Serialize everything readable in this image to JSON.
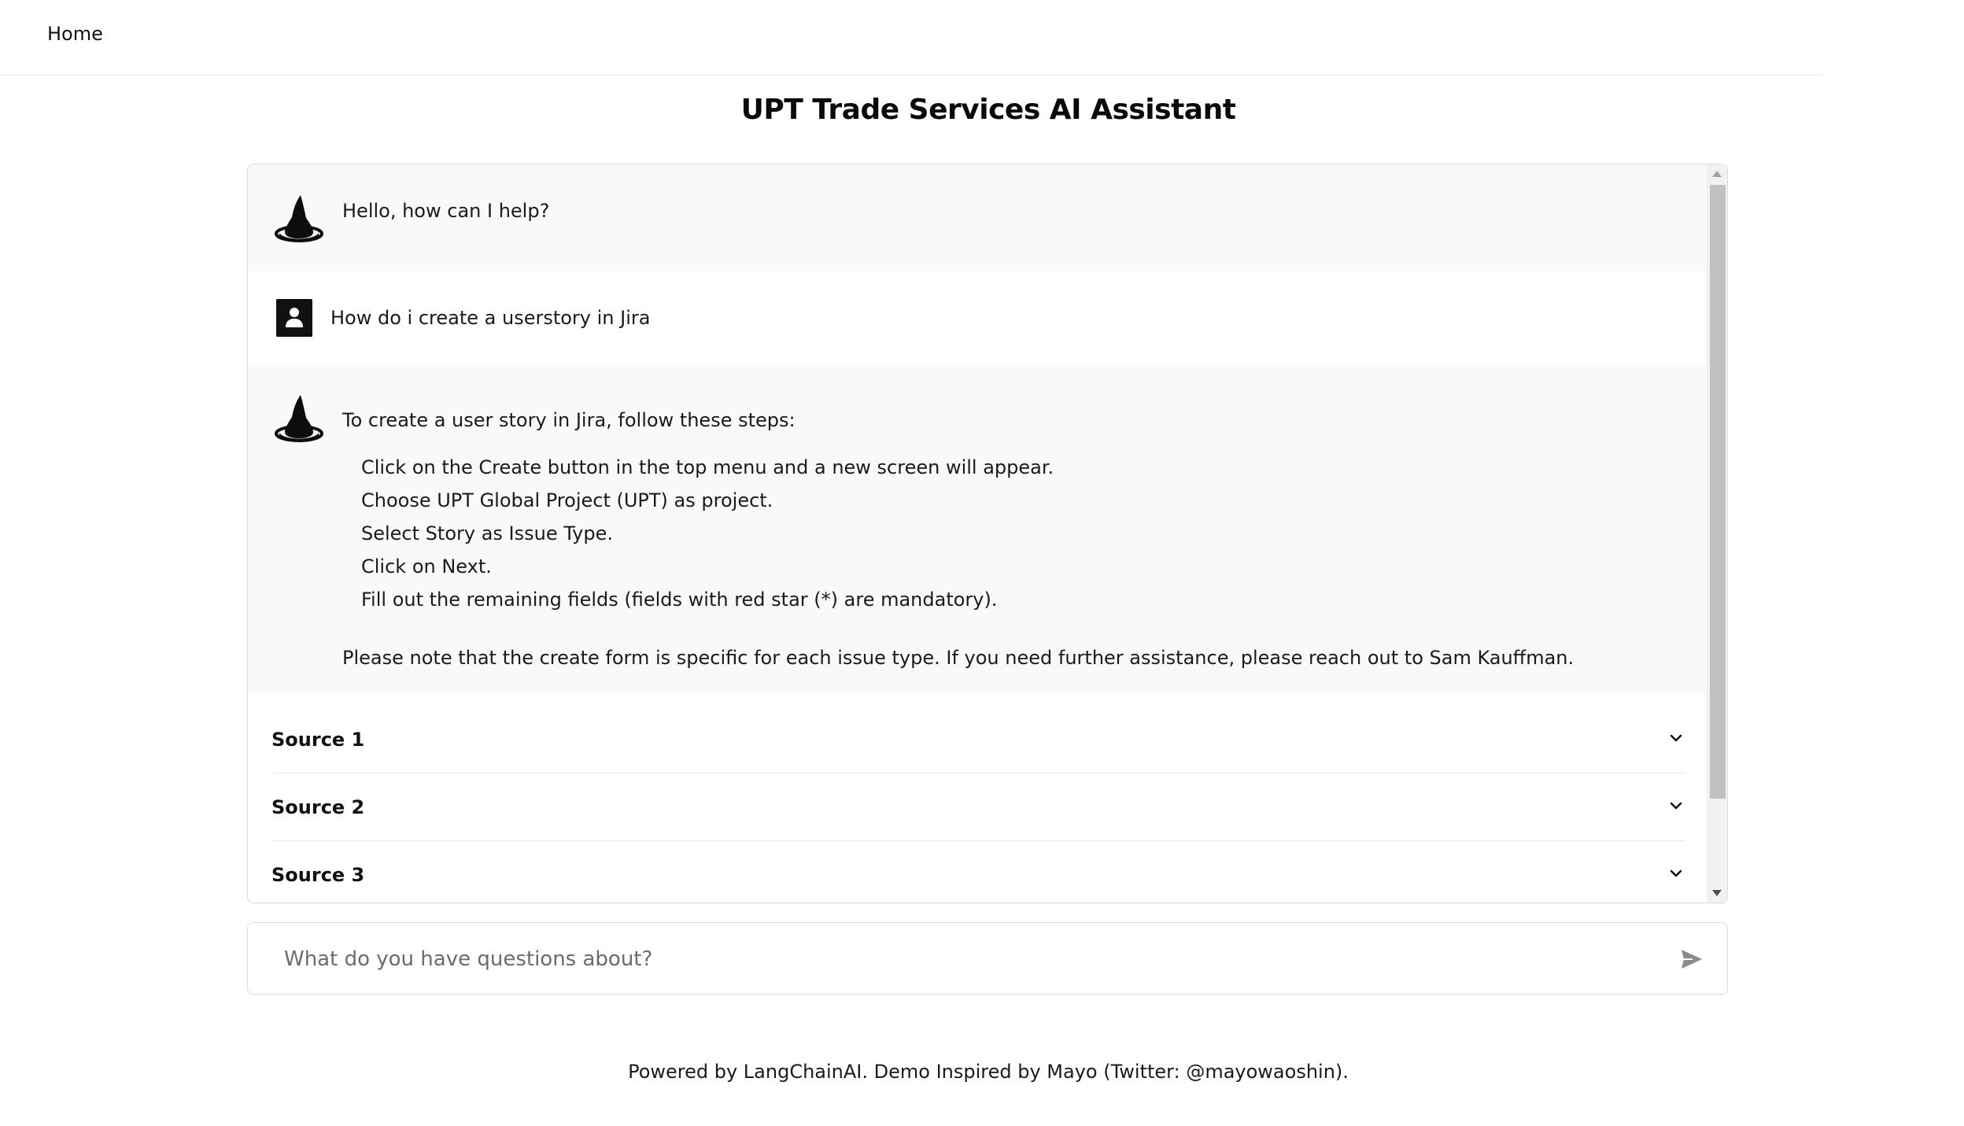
{
  "nav": {
    "home_label": "Home"
  },
  "page": {
    "title": "UPT Trade Services AI Assistant"
  },
  "messages": [
    {
      "role": "bot",
      "text": "Hello, how can I help?"
    },
    {
      "role": "user",
      "text": "How do i create a userstory in Jira"
    },
    {
      "role": "bot",
      "intro": "To create a user story in Jira, follow these steps:",
      "steps": [
        "Click on the Create button in the top menu and a new screen will appear.",
        "Choose UPT Global Project (UPT) as project.",
        "Select Story as Issue Type.",
        "Click on Next.",
        "Fill out the remaining fields (fields with red star (*) are mandatory)."
      ],
      "note": "Please note that the create form is specific for each issue type. If you need further assistance, please reach out to Sam Kauffman."
    }
  ],
  "sources": [
    {
      "label": "Source 1"
    },
    {
      "label": "Source 2"
    },
    {
      "label": "Source 3"
    }
  ],
  "input": {
    "placeholder": "What do you have questions about?",
    "value": ""
  },
  "footer": {
    "text": "Powered by LangChainAI. Demo Inspired by Mayo (Twitter: @mayowaoshin)."
  },
  "icons": {
    "bot_avatar": "wizard-hat-icon",
    "user_avatar": "user-icon",
    "expand": "chevron-down-icon",
    "send": "send-icon"
  },
  "colors": {
    "bot_message_bg": "#f8f9fa",
    "user_message_bg": "#ffffff",
    "border": "#dcdcdc",
    "scroll_thumb": "#c1c1c1"
  }
}
